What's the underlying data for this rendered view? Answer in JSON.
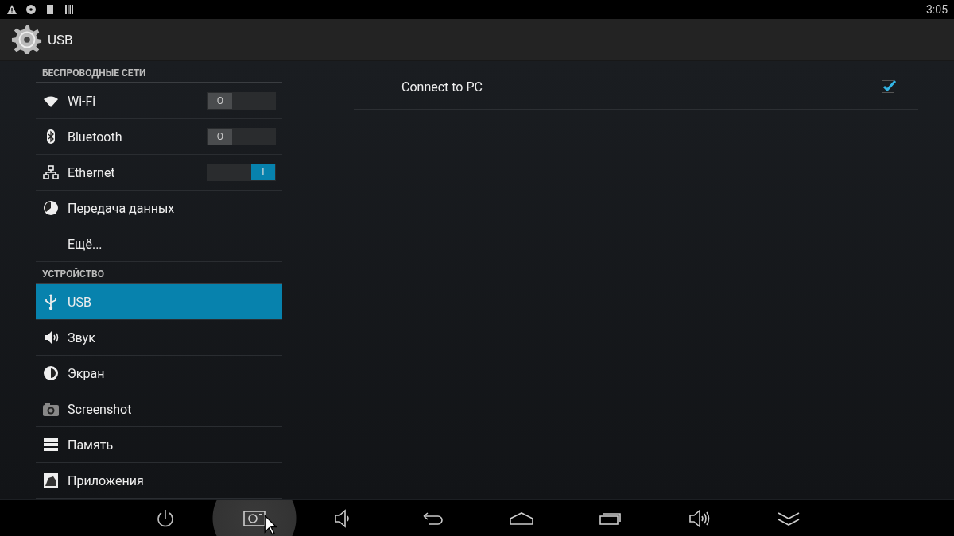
{
  "status_bar": {
    "time": "3:05"
  },
  "action_bar": {
    "title": "USB"
  },
  "sidebar": [
    {
      "kind": "header",
      "label": "БЕСПРОВОДНЫЕ СЕТИ"
    },
    {
      "kind": "item",
      "label": "Wi-Fi",
      "selected": false,
      "toggle": {
        "on": false,
        "label": "O"
      }
    },
    {
      "kind": "item",
      "label": "Bluetooth",
      "selected": false,
      "toggle": {
        "on": false,
        "label": "O"
      }
    },
    {
      "kind": "item",
      "label": "Ethernet",
      "selected": false,
      "toggle": {
        "on": true,
        "label": "I"
      }
    },
    {
      "kind": "item",
      "label": "Передача данных",
      "selected": false
    },
    {
      "kind": "item",
      "label": "Ещё...",
      "selected": false
    },
    {
      "kind": "header",
      "label": "УСТРОЙСТВО"
    },
    {
      "kind": "item",
      "label": "USB",
      "selected": true
    },
    {
      "kind": "item",
      "label": "Звук",
      "selected": false
    },
    {
      "kind": "item",
      "label": "Экран",
      "selected": false
    },
    {
      "kind": "item",
      "label": "Screenshot",
      "selected": false
    },
    {
      "kind": "item",
      "label": "Память",
      "selected": false
    },
    {
      "kind": "item",
      "label": "Приложения",
      "selected": false
    }
  ],
  "detail": [
    {
      "label": "Connect to PC",
      "checked": true
    }
  ],
  "nav_bar": [
    {
      "highlighted": false
    },
    {
      "highlighted": true
    },
    {
      "highlighted": false
    },
    {
      "highlighted": false
    },
    {
      "highlighted": false
    },
    {
      "highlighted": false
    },
    {
      "highlighted": false
    },
    {
      "highlighted": false
    }
  ]
}
